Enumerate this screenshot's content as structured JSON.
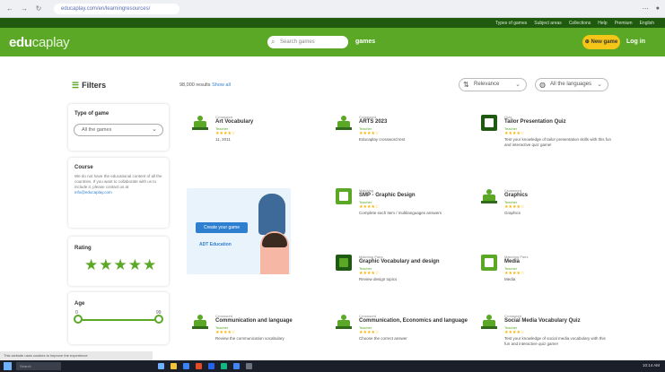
{
  "browser": {
    "url": "educaplay.com/en/learningresources/"
  },
  "topstrip": {
    "links": [
      "Types of games",
      "Subject areas",
      "Collections",
      "Help",
      "Premium",
      "English"
    ]
  },
  "header": {
    "logo_bold": "edu",
    "logo_light": "caplay",
    "search_placeholder": "Search games",
    "games_count": "games",
    "new_game": "New game",
    "login": "Log in"
  },
  "filters": {
    "title": "Filters",
    "type_of_game": {
      "label": "Type of game",
      "value": "All the games"
    },
    "course": {
      "label": "Course",
      "text": "We do not have the educational content of all the countries. If you want to collaborate with us to include it, please contact us at",
      "link": "info@educaplay.com"
    },
    "rating": {
      "label": "Rating",
      "stars": "★★★★★"
    },
    "age": {
      "label": "Age",
      "min": "0",
      "max": "99"
    }
  },
  "results": {
    "text": "98,000 results",
    "link_text": "Show all"
  },
  "sort": {
    "relevance": "Relevance",
    "all_languages": "All the languages"
  },
  "cards": [
    {
      "type": "Crossword",
      "title": "Art Vocabulary",
      "author": "Teacher",
      "stars": "★★★★☆",
      "desc": "11, 2011"
    },
    {
      "type": "Crossword",
      "title": "ARTS 2023",
      "author": "Teacher",
      "stars": "★★★★☆",
      "desc": "Educaplay crossword test"
    },
    {
      "type": "Quiz",
      "title": "Tailor Presentation Quiz",
      "author": "Teacher",
      "stars": "★★★★☆",
      "desc": "Test your knowledge of tailor presentation skills with this fun and interactive quiz game!"
    },
    {
      "type": "Matching",
      "title": "SMP - Graphic Design",
      "author": "Teacher",
      "stars": "★★★★☆",
      "desc": "Complete each item / multilanguages answers"
    },
    {
      "type": "Crossword",
      "title": "Graphics",
      "author": "Teacher",
      "stars": "★★★★☆",
      "desc": "Graphics"
    },
    {
      "type": "Matching Pairs",
      "title": "Graphic Vocabulary and design",
      "author": "Teacher",
      "stars": "★★★★☆",
      "desc": "Review design topics"
    },
    {
      "type": "Matching Pairs",
      "title": "Media",
      "author": "Teacher",
      "stars": "★★★★☆",
      "desc": "Media"
    },
    {
      "type": "Crossword",
      "title": "Communication and language",
      "author": "Teacher",
      "stars": "★★★★☆",
      "desc": "Review the communication vocabulary"
    },
    {
      "type": "Crossword",
      "title": "Communication, Economics and language",
      "author": "Teacher",
      "stars": "★★★★☆",
      "desc": "Choose the correct answer"
    },
    {
      "type": "Crossword",
      "title": "Social Media Vocabulary Quiz",
      "author": "Teacher",
      "stars": "★★★★☆",
      "desc": "Test your knowledge of social media vocabulary with this fun and interactive quiz game!"
    }
  ],
  "ad": {
    "button": "Create your game",
    "logo": "ADT Education"
  },
  "cookie": {
    "text": "This website uses cookies to improve the experience"
  },
  "taskbar": {
    "search": "Search",
    "clock": "10:14 AM"
  }
}
